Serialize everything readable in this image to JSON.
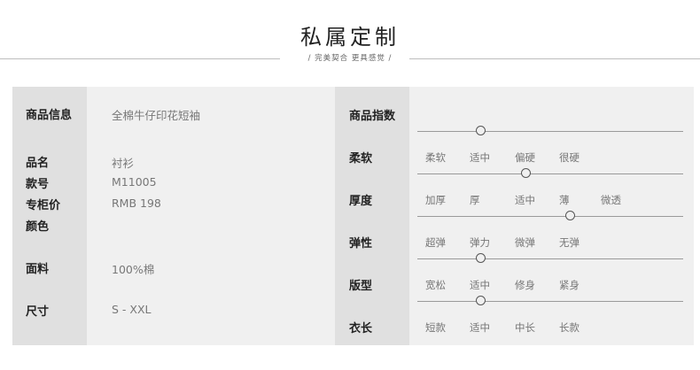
{
  "header": {
    "title": "私属定制",
    "subtitle": "/ 完美契合  更具感觉 /"
  },
  "info": {
    "product_info_label": "商品信息",
    "product_info_value": "全棉牛仔印花短袖",
    "name_label": "品名",
    "name_value": "衬衫",
    "model_label": "款号",
    "model_value": "M11005",
    "price_label": "专柜价",
    "price_value": "RMB 198",
    "color_label": "颜色",
    "fabric_label": "面料",
    "fabric_value": "100%棉",
    "size_label": "尺寸",
    "size_value": "S - XXL"
  },
  "index": {
    "title": "商品指数",
    "rows": [
      {
        "label": "柔软",
        "options": [
          "柔软",
          "适中",
          "偏硬",
          "很硬"
        ],
        "selected": 1
      },
      {
        "label": "厚度",
        "options": [
          "加厚",
          "厚",
          "适中",
          "薄",
          "微透"
        ],
        "selected": 2
      },
      {
        "label": "弹性",
        "options": [
          "超弹",
          "弹力",
          "微弹",
          "无弹"
        ],
        "selected": 3
      },
      {
        "label": "版型",
        "options": [
          "宽松",
          "适中",
          "修身",
          "紧身"
        ],
        "selected": 1
      },
      {
        "label": "衣长",
        "options": [
          "短款",
          "适中",
          "中长",
          "长款"
        ],
        "selected": 1
      }
    ]
  }
}
